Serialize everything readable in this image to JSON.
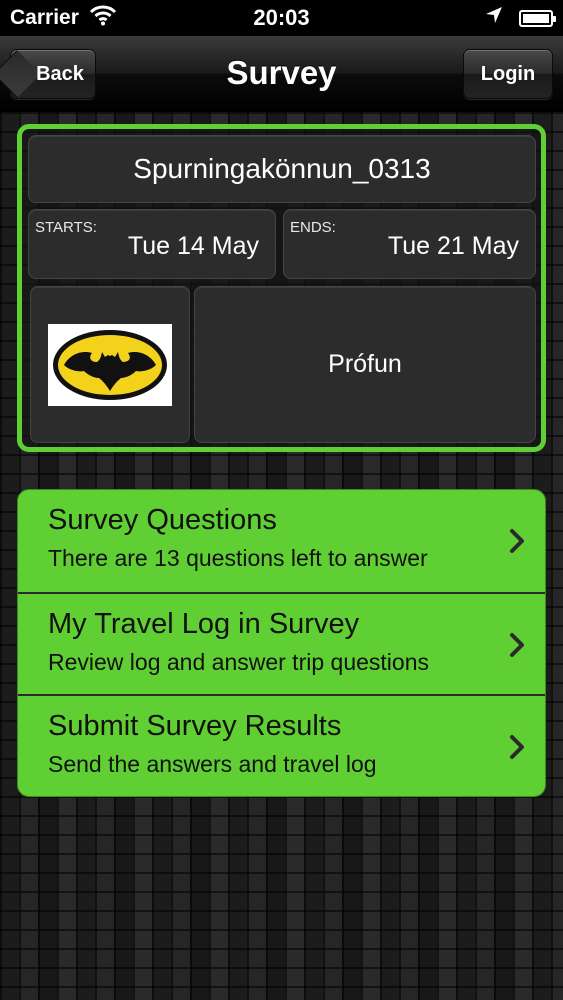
{
  "status_bar": {
    "carrier": "Carrier",
    "time": "20:03"
  },
  "nav": {
    "title": "Survey",
    "back_label": "Back",
    "login_label": "Login"
  },
  "survey": {
    "name": "Spurningakönnun_0313",
    "starts_label": "STARTS:",
    "starts_value": "Tue 14 May",
    "ends_label": "ENDS:",
    "ends_value": "Tue 21 May",
    "description": "Prófun",
    "logo_icon": "batman-logo-icon"
  },
  "menu": {
    "items": [
      {
        "title": "Survey Questions",
        "subtitle": "There are 13 questions left to answer"
      },
      {
        "title": "My Travel Log in Survey",
        "subtitle": "Review log and answer trip questions"
      },
      {
        "title": "Submit Survey Results",
        "subtitle": "Send the answers and travel log"
      }
    ]
  },
  "colors": {
    "accent": "#5fcf33",
    "nav_bg": "#1a1a1a"
  }
}
